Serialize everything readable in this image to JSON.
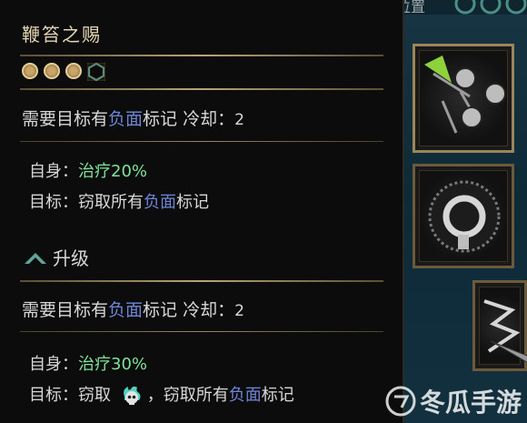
{
  "tooltip": {
    "title": "鞭笞之赐",
    "requirement_prefix": "需要目标有",
    "negative": "负面",
    "requirement_suffix": "标记",
    "cooldown_label": "冷却：",
    "cooldown_value": "2",
    "self_label": "自身：",
    "heal_base": "治疗20%",
    "target_label": "目标：",
    "steal_all": "窃取所有",
    "mark": "标记",
    "upgrade_label": "升级",
    "heal_upgrade": "治疗30%",
    "steal": "窃取",
    "comma": "，",
    "steal_all_2": "窃取所有",
    "mark_cut": "标记",
    "colors": {
      "negative": "#6d86d6",
      "heal": "#7ee29a",
      "title": "#e4d5b4"
    },
    "icons": [
      "filled-pip-icon",
      "filled-pip-icon",
      "filled-pip-icon",
      "empty-hex-pip-icon",
      "upgrade-chevron-icon",
      "skull-flame-icon"
    ]
  },
  "background": {
    "top_text": "位置"
  },
  "watermark": {
    "text": "冬瓜手游"
  }
}
